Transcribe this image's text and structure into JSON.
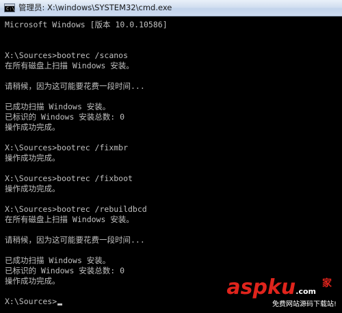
{
  "window": {
    "title": "管理员: X:\\windows\\SYSTEM32\\cmd.exe",
    "icon": "cmd-icon",
    "icon_glyph": "C:\\"
  },
  "console": {
    "lines": [
      "Microsoft Windows [版本 10.0.10586]",
      "",
      "",
      "X:\\Sources>bootrec /scanos",
      "在所有磁盘上扫描 Windows 安装。",
      "",
      "请稍候，因为这可能要花费一段时间...",
      "",
      "已成功扫描 Windows 安装。",
      "已标识的 Windows 安装总数: 0",
      "操作成功完成。",
      "",
      "X:\\Sources>bootrec /fixmbr",
      "操作成功完成。",
      "",
      "X:\\Sources>bootrec /fixboot",
      "操作成功完成。",
      "",
      "X:\\Sources>bootrec /rebuildbcd",
      "在所有磁盘上扫描 Windows 安装。",
      "",
      "请稍候，因为这可能要花费一段时间...",
      "",
      "已成功扫描 Windows 安装。",
      "已标识的 Windows 安装总数: 0",
      "操作成功完成。",
      "",
      "X:\\Sources>"
    ]
  },
  "watermark": {
    "logo": "aspku",
    "logo_suffix": ".com",
    "char": "家",
    "subtitle": "免费网站源码下载站!"
  },
  "colors": {
    "console_bg": "#000000",
    "console_text": "#c0c0c0",
    "watermark_red": "#e0241c"
  }
}
